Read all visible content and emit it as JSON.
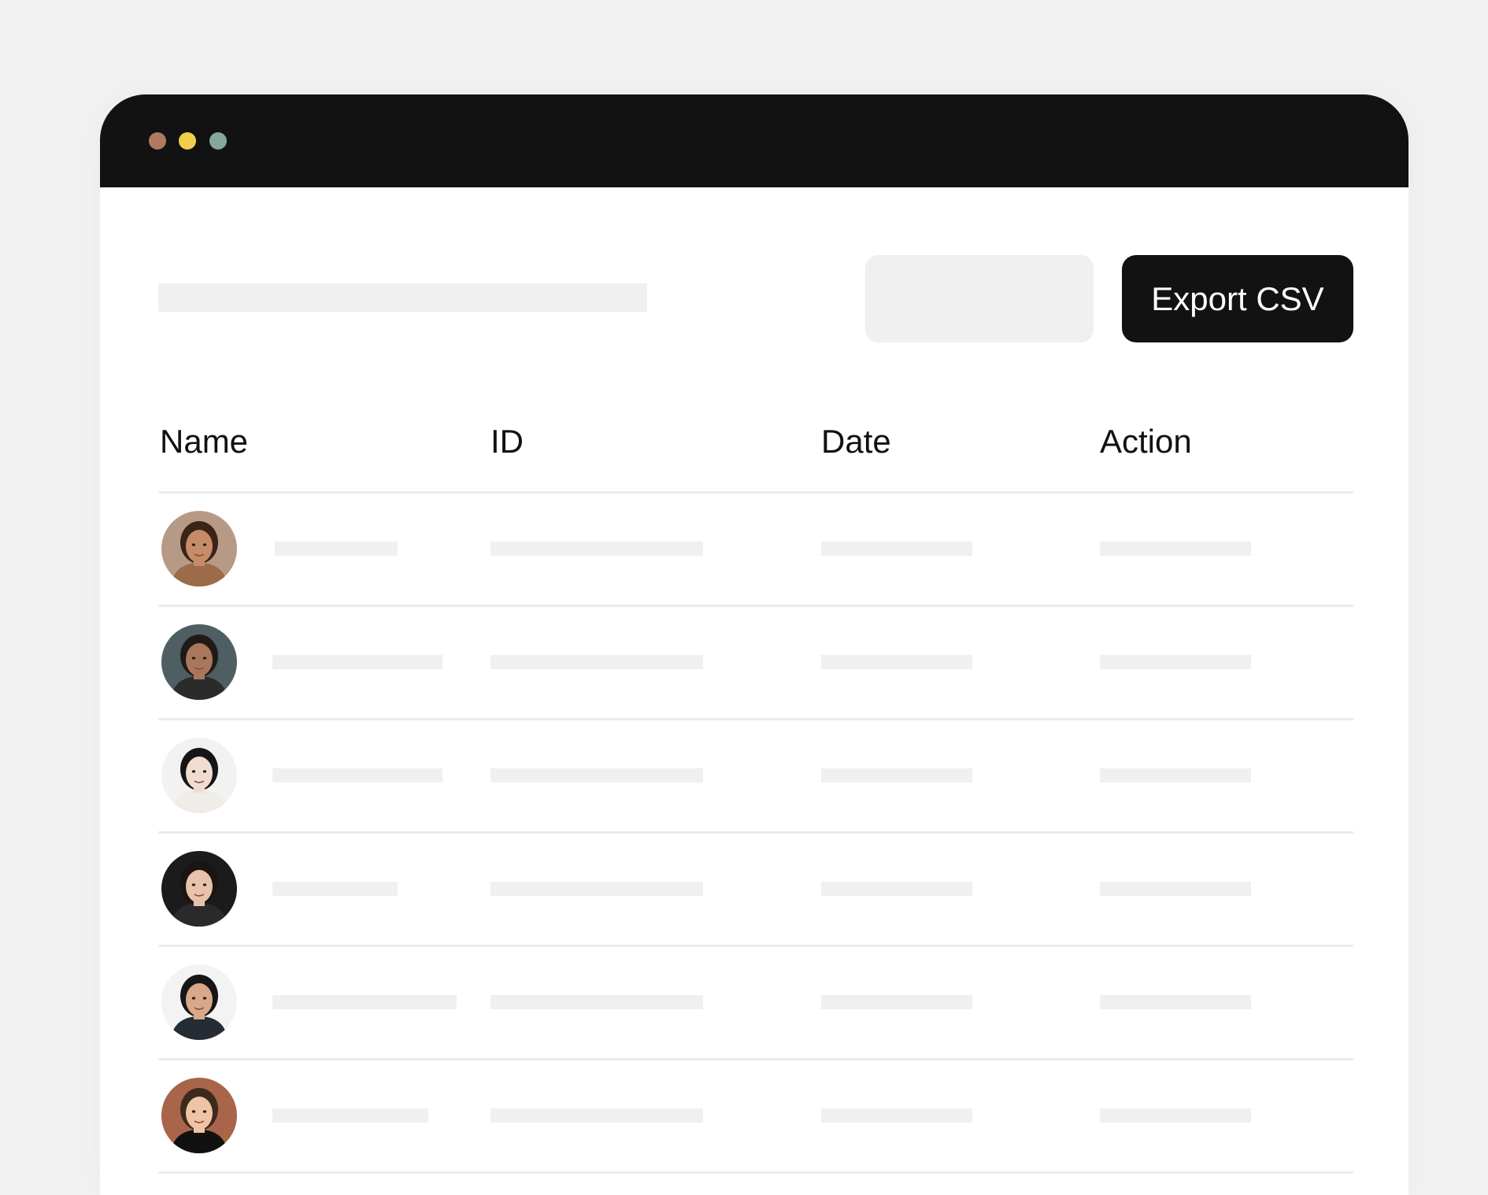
{
  "window": {
    "traffic_lights": [
      {
        "name": "close",
        "color": "#b07a62"
      },
      {
        "name": "minimize",
        "color": "#f0d04a"
      },
      {
        "name": "maximize",
        "color": "#86a79c"
      }
    ]
  },
  "toolbar": {
    "export_label": "Export CSV"
  },
  "table": {
    "headers": {
      "name": "Name",
      "id": "ID",
      "date": "Date",
      "action": "Action"
    },
    "rows": [
      {
        "avatar": "person-photo",
        "skin": "#c68b68",
        "hair": "#3a2418",
        "shirt": "#9b6b4a",
        "bg": "#b79a86"
      },
      {
        "avatar": "person-photo",
        "skin": "#a9785c",
        "hair": "#1f1a18",
        "shirt": "#2b2b2b",
        "bg": "#4f5e63"
      },
      {
        "avatar": "person-photo",
        "skin": "#f1ddd0",
        "hair": "#151515",
        "shirt": "#f0ece8",
        "bg": "#f2f2f2"
      },
      {
        "avatar": "person-photo",
        "skin": "#e8c2aa",
        "hair": "#1a1412",
        "shirt": "#2a2a2a",
        "bg": "#1b1b1b"
      },
      {
        "avatar": "person-photo",
        "skin": "#d9a889",
        "hair": "#161616",
        "shirt": "#262c33",
        "bg": "#f3f3f3"
      },
      {
        "avatar": "person-photo",
        "skin": "#efc4a6",
        "hair": "#3b2a1e",
        "shirt": "#111111",
        "bg": "#a8654a"
      }
    ]
  }
}
